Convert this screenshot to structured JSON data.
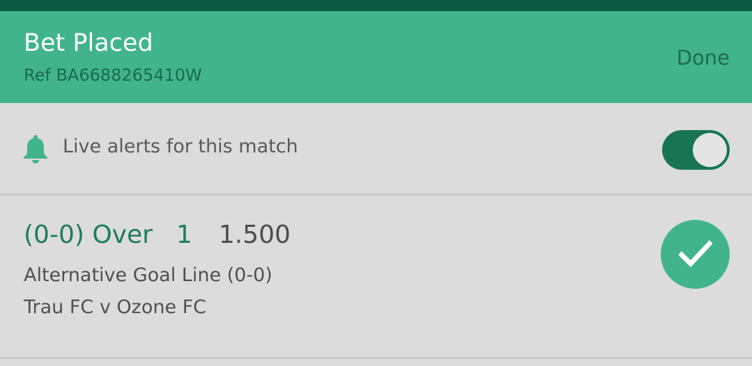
{
  "header": {
    "title": "Bet Placed",
    "ref": "Ref BA6688265410W",
    "done_label": "Done"
  },
  "alerts": {
    "icon": "bell-icon",
    "label": "Live alerts for this match",
    "toggle_on": true
  },
  "bet": {
    "selection": "(0-0) Over",
    "line": "1",
    "odds": "1.500",
    "market": "Alternative Goal Line (0-0)",
    "event": "Trau FC v Ozone FC",
    "status_icon": "check-icon"
  },
  "colors": {
    "header_bg": "#41b48c",
    "topbar": "#0c5a44",
    "accent_green": "#1e7d5b",
    "toggle_on": "#187553"
  }
}
